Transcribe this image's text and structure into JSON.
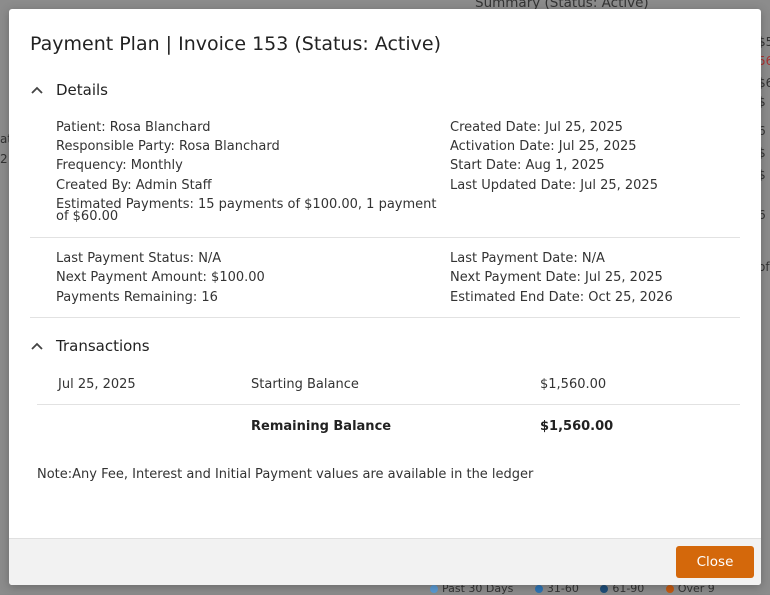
{
  "background": {
    "summary_title": "Summary (Status: Active)",
    "right_fragments": [
      "$5",
      "56",
      "$6",
      "$",
      "6",
      "$",
      "$",
      "6",
      "of"
    ],
    "left_fragments": [
      "at",
      "2"
    ],
    "legend": [
      {
        "label": "Past 30 Days",
        "color": "#5b9bd5"
      },
      {
        "label": "31-60",
        "color": "#2e75b6"
      },
      {
        "label": "61-90",
        "color": "#1f4e79"
      },
      {
        "label": "Over 9",
        "color": "#c55a11"
      }
    ]
  },
  "modal": {
    "title": "Payment Plan | Invoice 153 (Status: Active)",
    "details": {
      "header": "Details",
      "left": [
        "Patient: Rosa Blanchard",
        "Responsible Party: Rosa Blanchard",
        "Frequency: Monthly",
        "Created By: Admin Staff",
        "Estimated Payments: 15 payments of $100.00, 1 payment of $60.00"
      ],
      "right": [
        "Created Date: Jul 25, 2025",
        "Activation Date: Jul 25, 2025",
        "Start Date: Aug 1, 2025",
        "Last Updated Date: Jul 25, 2025"
      ],
      "left2": [
        "Last Payment Status: N/A",
        "Next Payment Amount: $100.00",
        "Payments Remaining: 16"
      ],
      "right2": [
        "Last Payment Date: N/A",
        "Next Payment Date: Jul 25, 2025",
        "Estimated End Date: Oct 25, 2026"
      ]
    },
    "transactions": {
      "header": "Transactions",
      "rows": [
        {
          "date": "Jul 25, 2025",
          "description": "Starting Balance",
          "amount": "$1,560.00"
        }
      ],
      "total": {
        "label": "Remaining Balance",
        "amount": "$1,560.00"
      }
    },
    "note": "Note:Any Fee, Interest and Initial Payment values are available in the ledger",
    "close_label": "Close",
    "accent_color": "#d4680b"
  }
}
